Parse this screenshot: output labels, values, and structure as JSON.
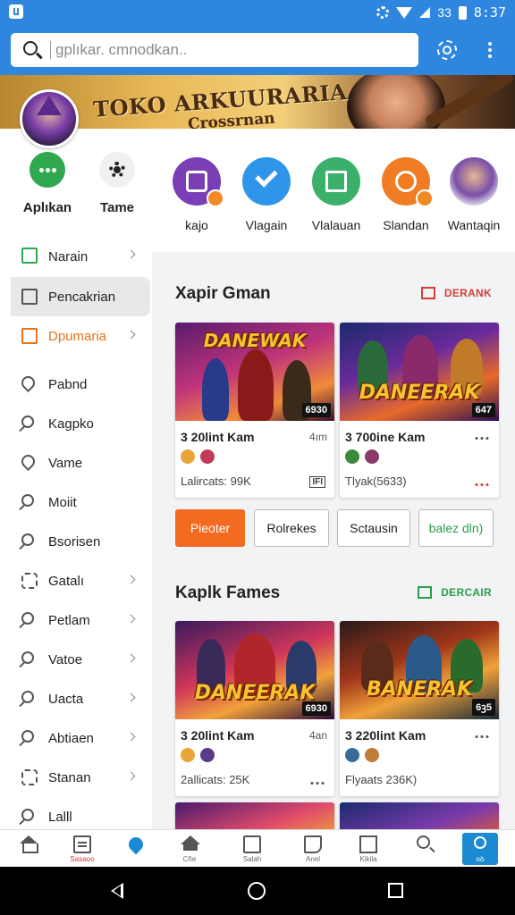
{
  "status_bar": {
    "time": "8:37",
    "signal_text": "33"
  },
  "search": {
    "placeholder": "gplıkar. cmnodkan.."
  },
  "banner": {
    "title": "TOKO ARKUURARIA",
    "subtitle": "Crossrnan"
  },
  "drawer": {
    "quick_actions": [
      {
        "label": "Aplıkan",
        "icon": "chat-bubble-icon"
      },
      {
        "label": "Tame",
        "icon": "gear-icon"
      }
    ],
    "items": [
      {
        "label": "Narain",
        "icon": "list-box-icon",
        "chevron": true
      },
      {
        "label": "Pencakrian",
        "icon": "clipboard-icon",
        "chevron": false,
        "active": true
      },
      {
        "label": "Dpumaria",
        "icon": "chat-box-icon",
        "chevron": true,
        "highlight": true
      },
      {
        "label": "Pabnd",
        "icon": "pin-icon",
        "chevron": false
      },
      {
        "label": "Kagpko",
        "icon": "search-icon",
        "chevron": false
      },
      {
        "label": "Vame",
        "icon": "pin-icon",
        "chevron": false
      },
      {
        "label": "Moiit",
        "icon": "search-icon",
        "chevron": false
      },
      {
        "label": "Bsorisen",
        "icon": "search-icon",
        "chevron": false
      },
      {
        "label": "Gatalı",
        "icon": "puzzle-icon",
        "chevron": true
      },
      {
        "label": "Petlam",
        "icon": "search-icon",
        "chevron": true
      },
      {
        "label": "Vatoe",
        "icon": "search-icon",
        "chevron": true
      },
      {
        "label": "Uacta",
        "icon": "search-icon",
        "chevron": true
      },
      {
        "label": "Abtiaen",
        "icon": "search-icon",
        "chevron": true
      },
      {
        "label": "Stanan",
        "icon": "puzzle-icon",
        "chevron": true
      },
      {
        "label": "Lalll",
        "icon": "search-icon",
        "chevron": false
      }
    ]
  },
  "categories": [
    {
      "label": "kajo",
      "color": "#7b3fb5"
    },
    {
      "label": "Vlagain",
      "color": "#2e95e8"
    },
    {
      "label": "Vlalauan",
      "color": "#3bb06a"
    },
    {
      "label": "Slandan",
      "color": "#f07c24"
    },
    {
      "label": "Wantaqin",
      "color": "#d9d0e8"
    }
  ],
  "section1": {
    "title": "Xapir Gman",
    "action": "DERANK",
    "action_color": "#d0413b",
    "cards": [
      {
        "thumb_title": "DANEWAK",
        "badge": "6930",
        "title": "3 20lint Kam",
        "meta": "4ım",
        "players": "Lalircats: 99K",
        "tag": "IFI"
      },
      {
        "thumb_title": "DANEERAK",
        "badge": "647",
        "title": "3 700ine Kam",
        "meta": "",
        "players": "Tlyak(5633)",
        "tag": ""
      }
    ]
  },
  "chips": [
    {
      "label": "Pieoter",
      "active": true
    },
    {
      "label": "Rolrekes",
      "active": false
    },
    {
      "label": "Sctausin",
      "active": false
    },
    {
      "label": "balez dln)",
      "active": false
    }
  ],
  "section2": {
    "title": "Kaplk Fames",
    "action": "DERCAIR",
    "action_color": "#2a9d4a",
    "cards": [
      {
        "thumb_title": "DANEERAK",
        "badge": "6930",
        "title": "3 20lint Kam",
        "meta": "4an",
        "players": "2allicats: 25K"
      },
      {
        "thumb_title": "BANERAK",
        "badge": "6ꝫ5",
        "title": "3 220lint Kam",
        "meta": "",
        "players": "Flyaats 236K)"
      }
    ]
  },
  "tabs": [
    {
      "label": "",
      "icon": "home-icon"
    },
    {
      "label": "Sasaoo",
      "icon": "document-icon"
    },
    {
      "label": "",
      "icon": "heart-icon"
    },
    {
      "label": "Cñe",
      "icon": "roof-icon"
    },
    {
      "label": "Salah",
      "icon": "phone-icon"
    },
    {
      "label": "Anel",
      "icon": "flag-icon"
    },
    {
      "label": "Kikila",
      "icon": "square-icon"
    },
    {
      "label": "",
      "icon": "search-icon"
    },
    {
      "label": "oꝺ",
      "icon": "user-icon"
    }
  ]
}
